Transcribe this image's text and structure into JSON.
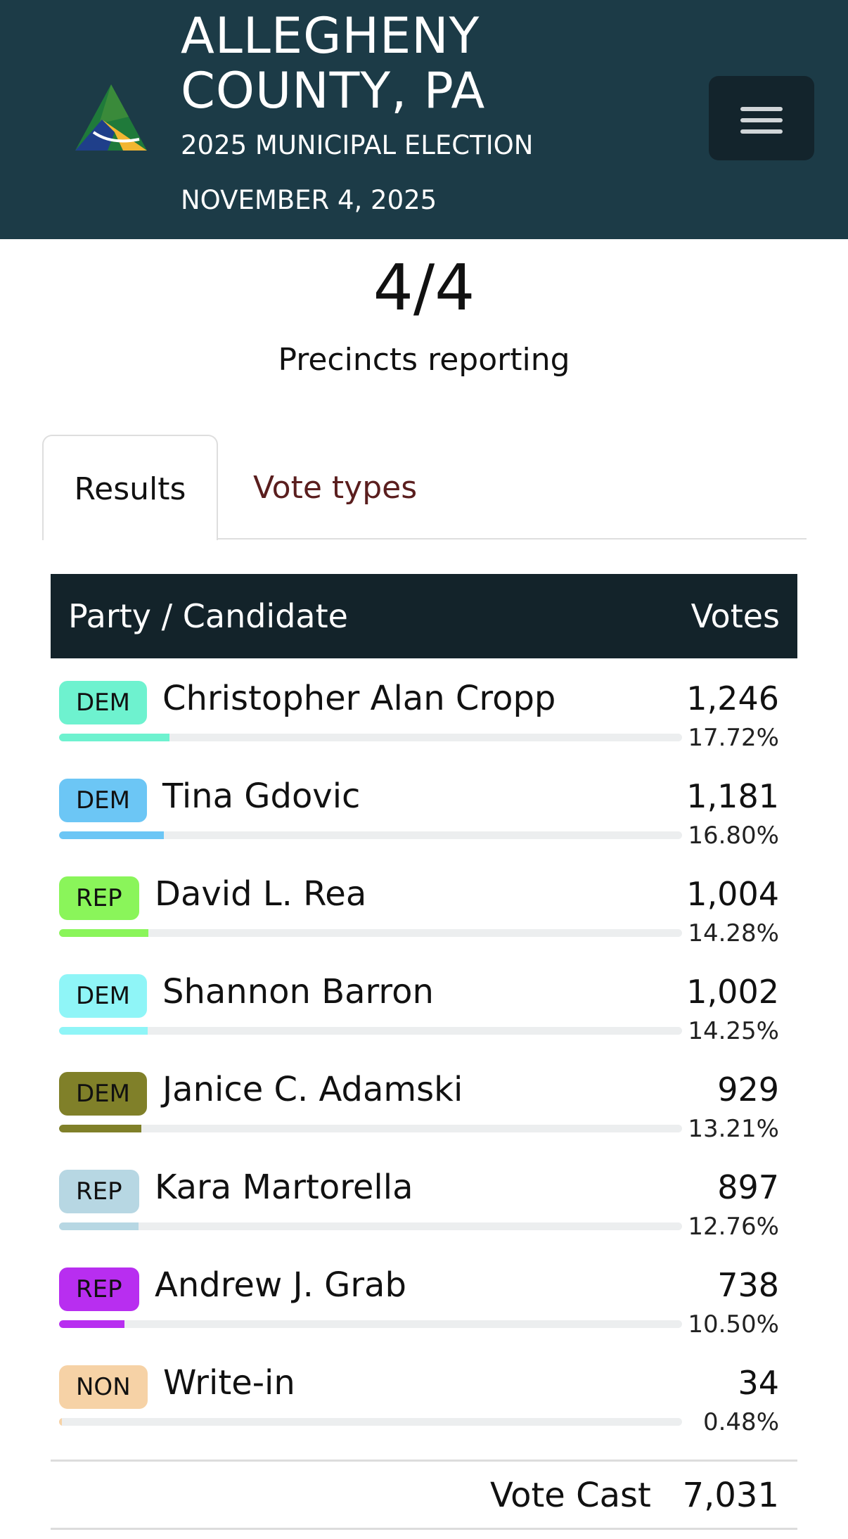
{
  "header": {
    "title": "ALLEGHENY COUNTY, PA",
    "subtitle": "2025 MUNICIPAL ELECTION",
    "date": "NOVEMBER 4, 2025",
    "logo_icon": "county-triangle-logo-icon",
    "menu_icon": "hamburger-menu-icon",
    "background_color": "#1c3b47"
  },
  "precincts": {
    "count": "4/4",
    "label": "Precincts reporting"
  },
  "tabs": [
    {
      "label": "Results",
      "active": true
    },
    {
      "label": "Vote types",
      "active": false
    }
  ],
  "table": {
    "header_candidate": "Party / Candidate",
    "header_votes": "Votes",
    "rows": [
      {
        "party": "DEM",
        "name": "Christopher Alan Cropp",
        "votes": "1,246",
        "pct": "17.72%",
        "share": 17.72,
        "color": "#6ef2cf"
      },
      {
        "party": "DEM",
        "name": "Tina Gdovic",
        "votes": "1,181",
        "pct": "16.80%",
        "share": 16.8,
        "color": "#6cc6f5"
      },
      {
        "party": "REP",
        "name": "David L. Rea",
        "votes": "1,004",
        "pct": "14.28%",
        "share": 14.28,
        "color": "#8af55a"
      },
      {
        "party": "DEM",
        "name": "Shannon Barron",
        "votes": "1,002",
        "pct": "14.25%",
        "share": 14.25,
        "color": "#8ff5f7"
      },
      {
        "party": "DEM",
        "name": "Janice C. Adamski",
        "votes": "929",
        "pct": "13.21%",
        "share": 13.21,
        "color": "#808029"
      },
      {
        "party": "REP",
        "name": "Kara Martorella",
        "votes": "897",
        "pct": "12.76%",
        "share": 12.76,
        "color": "#b7d7e3"
      },
      {
        "party": "REP",
        "name": "Andrew J. Grab",
        "votes": "738",
        "pct": "10.50%",
        "share": 10.5,
        "color": "#b82ef0"
      },
      {
        "party": "NON",
        "name": "Write-in",
        "votes": "34",
        "pct": "0.48%",
        "share": 0.48,
        "color": "#f6d2a6"
      }
    ],
    "total_label": "Vote Cast",
    "total_value": "7,031"
  }
}
